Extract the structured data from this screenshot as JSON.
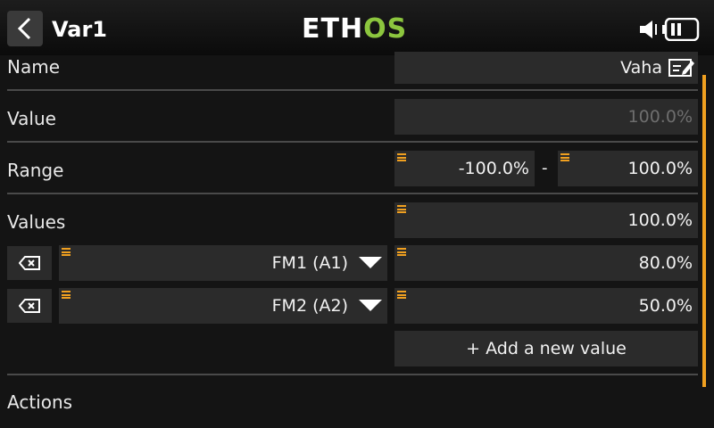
{
  "header": {
    "title": "Var1",
    "logo_white": "ETH",
    "logo_green": "OS",
    "colors": {
      "logo_green": "#8cc63e",
      "accent": "#f0a020"
    },
    "icons": [
      "back-arrow-icon",
      "speaker-icon",
      "battery-icon"
    ]
  },
  "rows": {
    "name": {
      "label": "Name",
      "value": "Vaha"
    },
    "value": {
      "label": "Value",
      "value": "100.0%"
    },
    "range": {
      "label": "Range",
      "min": "-100.0%",
      "separator": "-",
      "max": "100.0%"
    },
    "values": {
      "label": "Values",
      "default": "100.0%"
    }
  },
  "value_entries": [
    {
      "mode": "FM1 (A1)",
      "value": "80.0%"
    },
    {
      "mode": "FM2 (A2)",
      "value": "50.0%"
    }
  ],
  "add_button_label": "+ Add a new value",
  "actions_label": "Actions"
}
